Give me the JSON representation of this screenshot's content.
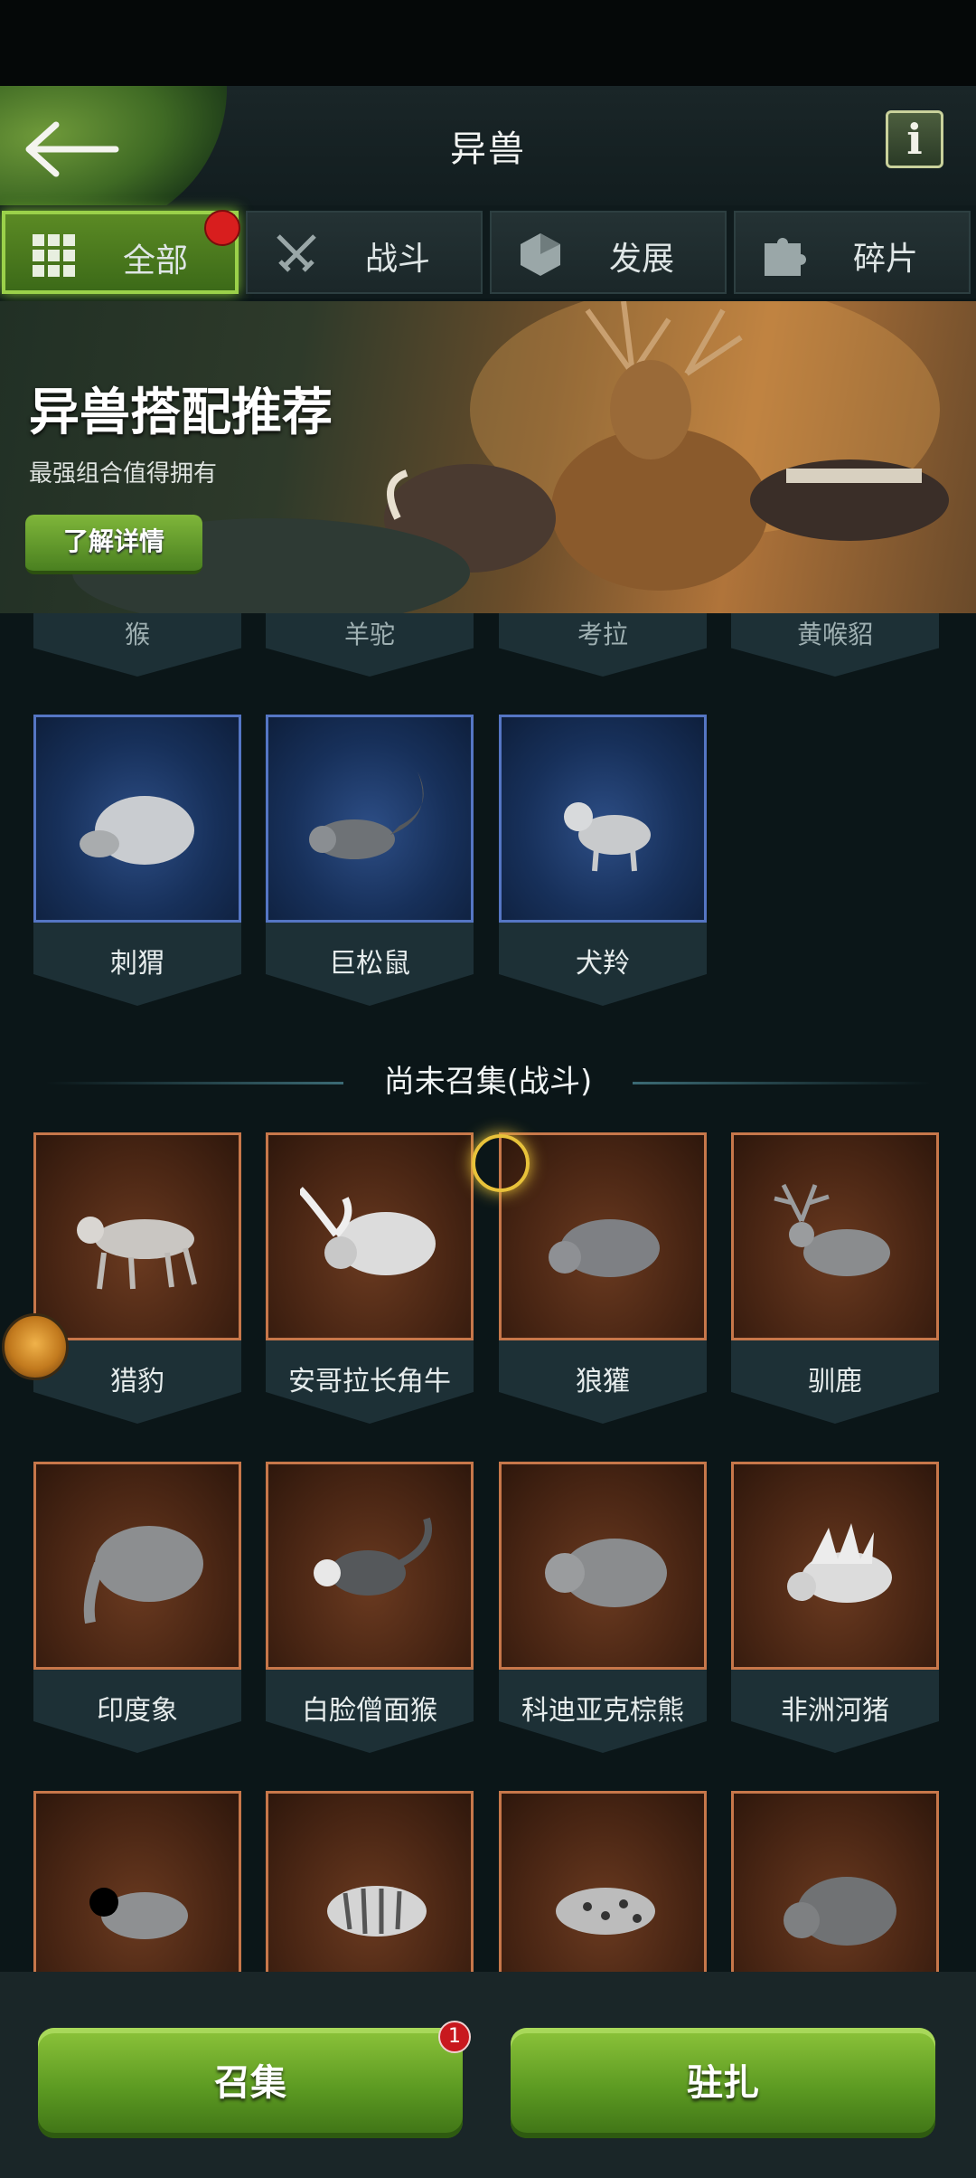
{
  "header": {
    "title": "异兽",
    "info_label": "i"
  },
  "tabs": [
    {
      "label": "全部",
      "icon": "grid-icon"
    },
    {
      "label": "战斗",
      "icon": "swords-icon"
    },
    {
      "label": "发展",
      "icon": "hexagon-icon"
    },
    {
      "label": "碎片",
      "icon": "puzzle-icon"
    }
  ],
  "banner": {
    "title": "异兽搭配推荐",
    "subtitle": "最强组合值得拥有",
    "button_label": "了解详情"
  },
  "partial_top_row": [
    "猴",
    "羊驼",
    "考拉",
    "黄喉貂"
  ],
  "owned": [
    {
      "name": "刺猬"
    },
    {
      "name": "巨松鼠"
    },
    {
      "name": "犬羚"
    }
  ],
  "section_title": "尚未召集(战斗)",
  "uncollected": [
    {
      "name": "猎豹"
    },
    {
      "name": "安哥拉长角牛"
    },
    {
      "name": "狼獾"
    },
    {
      "name": "驯鹿"
    },
    {
      "name": "印度象"
    },
    {
      "name": "白脸僧面猴"
    },
    {
      "name": "科迪亚克棕熊"
    },
    {
      "name": "非洲河猪"
    }
  ],
  "bottom": {
    "summon_label": "召集",
    "station_label": "驻扎",
    "summon_badge": "1"
  },
  "colors": {
    "accent_green": "#6fa82a",
    "owned_border": "#5576c4",
    "uncollected_border": "#c7774a",
    "badge_red": "#c8181e"
  }
}
